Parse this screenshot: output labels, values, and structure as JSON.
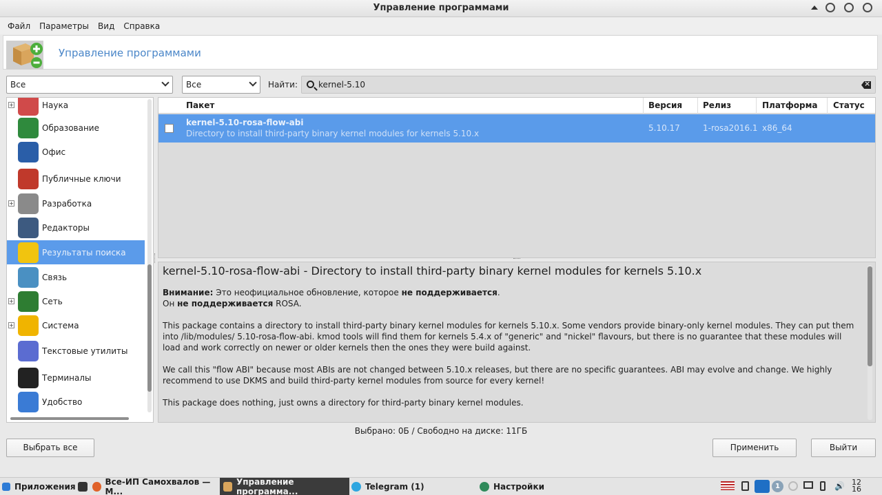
{
  "window": {
    "title": "Управление программами"
  },
  "menu": [
    "Файл",
    "Параметры",
    "Вид",
    "Справка"
  ],
  "header": {
    "title": "Управление программами"
  },
  "filters": {
    "group": "Все",
    "status": "Все",
    "find_label": "Найти:",
    "search_value": "kernel-5.10"
  },
  "sidebar": {
    "items": [
      {
        "label": "Наука",
        "icon": "science-icon",
        "expandable": true
      },
      {
        "label": "Образование",
        "icon": "education-icon",
        "expandable": false
      },
      {
        "label": "Офис",
        "icon": "office-icon",
        "expandable": false
      },
      {
        "label": "Публичные ключи",
        "icon": "public-keys-icon",
        "expandable": false
      },
      {
        "label": "Разработка",
        "icon": "development-icon",
        "expandable": true
      },
      {
        "label": "Редакторы",
        "icon": "editors-icon",
        "expandable": false
      },
      {
        "label": "Результаты поиска",
        "icon": "search-results-icon",
        "expandable": false,
        "selected": true
      },
      {
        "label": "Связь",
        "icon": "communication-icon",
        "expandable": false
      },
      {
        "label": "Сеть",
        "icon": "network-icon",
        "expandable": true
      },
      {
        "label": "Система",
        "icon": "system-icon",
        "expandable": true
      },
      {
        "label": "Текстовые утилиты",
        "icon": "text-tools-icon",
        "expandable": false
      },
      {
        "label": "Терминалы",
        "icon": "terminal-icon",
        "expandable": false
      },
      {
        "label": "Удобство",
        "icon": "accessibility-icon",
        "expandable": false
      }
    ]
  },
  "table": {
    "columns": [
      "Пакет",
      "Версия",
      "Релиз",
      "Платформа",
      "Статус"
    ],
    "rows": [
      {
        "name": "kernel-5.10-rosa-flow-abi",
        "summary": "Directory to install third-party binary kernel modules for kernels 5.10.x",
        "version": "5.10.17",
        "release": "1-rosa2016.1",
        "platform": "x86_64",
        "status": ""
      }
    ]
  },
  "description": {
    "title": "kernel-5.10-rosa-flow-abi - Directory to install third-party binary kernel modules for kernels 5.10.x",
    "warn_label": "Внимание:",
    "warn_text1": " Это неофициальное обновление, которое ",
    "warn_bold1": "не поддерживается",
    "warn_text2": ".",
    "warn_line2_a": "Он ",
    "warn_bold2": "не поддерживается",
    "warn_line2_b": " ROSA.",
    "p1": "This package contains a directory to install third-party binary kernel modules for kernels 5.10.x. Some vendors provide binary-only kernel modules. They can put them into /lib/modules/ 5.10-rosa-flow-abi. kmod tools will find them for kernels 5.4.x of \"generic\" and \"nickel\" flavours, but there is no guarantee that these modules will load and work correctly on newer or older kernels then the ones they were build against.",
    "p2": "We call this \"flow ABI\" because most ABIs are not changed between 5.10.x releases, but there are no specific guarantees. ABI may evolve and change. We highly recommend to use DKMS and build third-party kernel modules from source for every kernel!",
    "p3": "This package does nothing, just owns a directory for third-party binary kernel modules."
  },
  "statusbar": "Выбрано: 0Б / Свободно на диске: 11ГБ",
  "buttons": {
    "select_all": "Выбрать все",
    "apply": "Применить",
    "quit": "Выйти"
  },
  "taskbar": {
    "apps_label": "Приложения",
    "tasks": [
      {
        "label": "Все-ИП Самохвалов — М...",
        "icon": "firefox-icon"
      },
      {
        "label": "Управление программа...",
        "icon": "package-manager-icon",
        "active": true
      },
      {
        "label": "Telegram (1)",
        "icon": "telegram-icon"
      },
      {
        "label": "Настройки",
        "icon": "settings-icon"
      }
    ],
    "badge": "1",
    "clock_hour": "12",
    "clock_min": "16"
  },
  "colors": {
    "selection": "#5a9bea",
    "header_title": "#4a86c8",
    "taskbar_active": "#3b3b3b"
  }
}
